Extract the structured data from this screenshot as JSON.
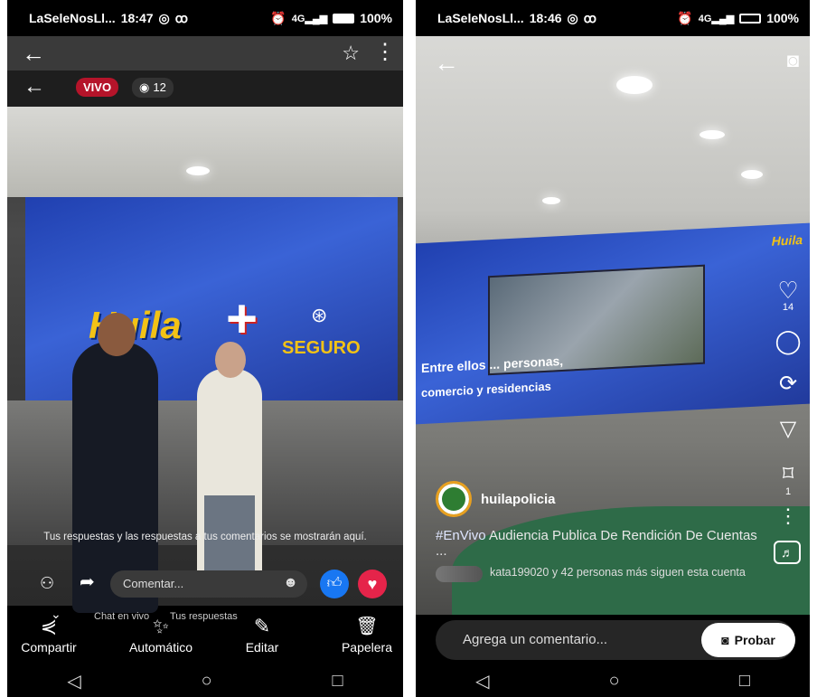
{
  "left": {
    "status": {
      "carrier": "LaSeleNosLl...",
      "time": "18:47",
      "battery": "100%"
    },
    "viewer": {
      "live_badge": "VIVO",
      "viewers": "12"
    },
    "video": {
      "brand_main": "Huila",
      "brand_sub": "SEGURO"
    },
    "comments_info": "Tus respuestas y las respuestas a tus comentarios se mostrarán aquí.",
    "comment_placeholder": "Comentar...",
    "tabs": {
      "chat": "Chat en vivo",
      "replies": "Tus respuestas"
    },
    "actions": [
      {
        "label": "Compartir",
        "icon": "share-icon"
      },
      {
        "label": "Automático",
        "icon": "magic-wand-icon"
      },
      {
        "label": "Editar",
        "icon": "brush-icon"
      },
      {
        "label": "Papelera",
        "icon": "trash-icon"
      }
    ]
  },
  "right": {
    "status": {
      "carrier": "LaSeleNosLl...",
      "time": "18:46",
      "battery": "100%"
    },
    "video_text": {
      "line1": "Entre ellos ... personas,",
      "line2": "comercio y residencias",
      "brand": "Huila"
    },
    "side": {
      "likes": "14",
      "saves": "1"
    },
    "account": {
      "name": "huilapolicia"
    },
    "caption": {
      "hashtag": "#EnVivo",
      "text": " Audiencia Publica De Rendición De Cuentas ..."
    },
    "followers": {
      "user": "kata199020",
      "rest": " y 42 personas más siguen esta cuenta"
    },
    "comment_placeholder": "Agrega un comentario...",
    "try_button": "Probar"
  },
  "colors": {
    "live_red": "#b5142a",
    "fb_blue": "#1877f2",
    "heart_red": "#e5244a"
  }
}
